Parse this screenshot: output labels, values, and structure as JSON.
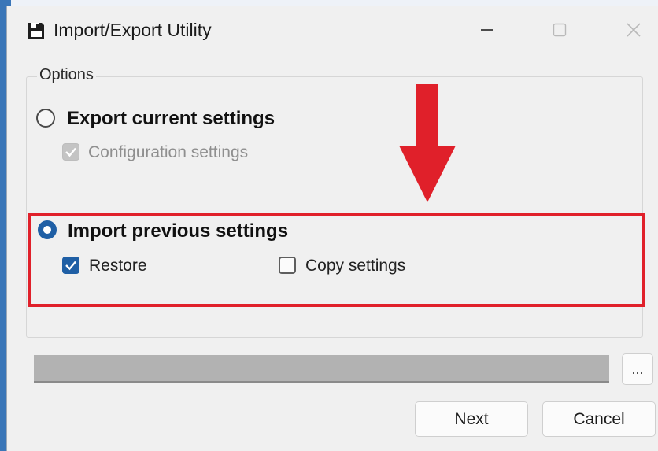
{
  "window": {
    "title": "Import/Export Utility"
  },
  "options": {
    "group_label": "Options",
    "export": {
      "label": "Export current settings",
      "selected": false,
      "configuration_settings": {
        "label": "Configuration settings",
        "checked": true,
        "enabled": false
      }
    },
    "import": {
      "label": "Import previous settings",
      "selected": true,
      "restore": {
        "label": "Restore",
        "checked": true
      },
      "copy_settings": {
        "label": "Copy settings",
        "checked": false
      }
    }
  },
  "path": {
    "value": "",
    "browse_label": "..."
  },
  "buttons": {
    "next": "Next",
    "cancel": "Cancel"
  },
  "colors": {
    "accent": "#1f5fa5",
    "annotation_red": "#e0202a"
  },
  "icons": {
    "app": "floppy-disk-icon",
    "minimize": "minimize-icon",
    "maximize": "maximize-icon",
    "close": "close-icon",
    "annotation": "down-arrow-icon"
  }
}
